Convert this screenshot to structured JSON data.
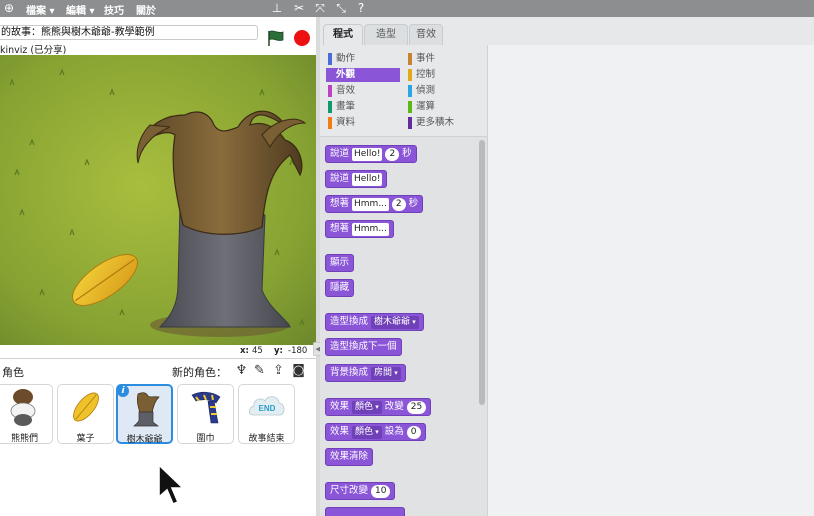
{
  "menu": {
    "file": "檔案",
    "edit": "編輯",
    "tips": "技巧",
    "about": "關於"
  },
  "project": {
    "title": "的故事：熊熊與樹木爺爺-教學範例",
    "owner": "kinviz (已分享)"
  },
  "coords": {
    "x_label": "x:",
    "x_value": "45",
    "y_label": "y:",
    "y_value": "-180"
  },
  "sprites": {
    "title": "角色",
    "new_label": "新的角色：",
    "items": [
      {
        "name": "熊熊們"
      },
      {
        "name": "葉子"
      },
      {
        "name": "樹木爺爺"
      },
      {
        "name": "圍巾"
      },
      {
        "name": "故事結束",
        "thumb_text": "END"
      }
    ]
  },
  "tabs": {
    "scripts": "程式",
    "costumes": "造型",
    "sounds": "音效"
  },
  "categories": [
    {
      "label": "動作",
      "color": "#4a6cd4"
    },
    {
      "label": "事件",
      "color": "#c88330"
    },
    {
      "label": "外觀",
      "color": "#8a55d7"
    },
    {
      "label": "控制",
      "color": "#e1a91a"
    },
    {
      "label": "音效",
      "color": "#bb42c3"
    },
    {
      "label": "偵測",
      "color": "#2ca5e2"
    },
    {
      "label": "畫筆",
      "color": "#0e9a6c"
    },
    {
      "label": "運算",
      "color": "#5cb712"
    },
    {
      "label": "資料",
      "color": "#ee7d16"
    },
    {
      "label": "更多積木",
      "color": "#632d99"
    }
  ],
  "blocks": {
    "say_for": {
      "t1": "說道",
      "msg": "Hello!",
      "secs": "2",
      "t2": "秒"
    },
    "say": {
      "t1": "說道",
      "msg": "Hello!"
    },
    "think_for": {
      "t1": "想著",
      "msg": "Hmm...",
      "secs": "2",
      "t2": "秒"
    },
    "think": {
      "t1": "想著",
      "msg": "Hmm..."
    },
    "show": "顯示",
    "hide": "隱藏",
    "switch_costume": {
      "t1": "造型換成",
      "opt": "樹木爺爺"
    },
    "next_costume": "造型換成下一個",
    "switch_backdrop": {
      "t1": "背景換成",
      "opt": "房間"
    },
    "change_effect": {
      "t1": "效果",
      "opt": "顏色",
      "t2": "改變",
      "val": "25"
    },
    "set_effect": {
      "t1": "效果",
      "opt": "顏色",
      "t2": "設為",
      "val": "0"
    },
    "clear_effects": "效果清除",
    "change_size": {
      "t1": "尺寸改變",
      "val": "10"
    }
  },
  "colors": {
    "looks": "#8a55d7",
    "menubar": "#8c8e90",
    "selected_border": "#2c8de0",
    "stop": "#ee1111"
  }
}
